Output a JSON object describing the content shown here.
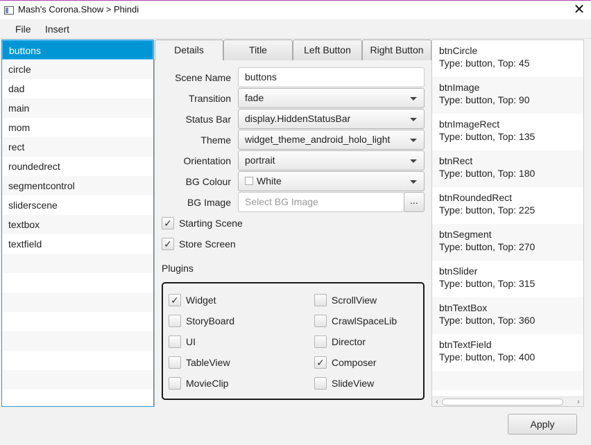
{
  "window": {
    "title": "Mash's Corona.Show > Phindi",
    "close_glyph": "✕"
  },
  "menu": {
    "file": "File",
    "insert": "Insert"
  },
  "scenes": [
    "buttons",
    "circle",
    "dad",
    "main",
    "mom",
    "rect",
    "roundedrect",
    "segmentcontrol",
    "sliderscene",
    "textbox",
    "textfield"
  ],
  "selected_scene": "buttons",
  "tabs": [
    "Details",
    "Title",
    "Left Button",
    "Right Button"
  ],
  "form": {
    "scene_name_label": "Scene Name",
    "scene_name_value": "buttons",
    "transition_label": "Transition",
    "transition_value": "fade",
    "status_bar_label": "Status Bar",
    "status_bar_value": "display.HiddenStatusBar",
    "theme_label": "Theme",
    "theme_value": "widget_theme_android_holo_light",
    "orientation_label": "Orientation",
    "orientation_value": "portrait",
    "bg_colour_label": "BG Colour",
    "bg_colour_value": "White",
    "bg_colour_swatch": "#ffffff",
    "bg_image_label": "BG Image",
    "bg_image_placeholder": "Select BG Image",
    "browse_label": "...",
    "starting_scene_label": "Starting Scene",
    "starting_scene_checked": true,
    "store_screen_label": "Store Screen",
    "store_screen_checked": true
  },
  "plugins": {
    "label": "Plugins",
    "left": [
      {
        "name": "Widget",
        "checked": true
      },
      {
        "name": "StoryBoard",
        "checked": false
      },
      {
        "name": "UI",
        "checked": false
      },
      {
        "name": "TableView",
        "checked": false
      },
      {
        "name": "MovieClip",
        "checked": false
      }
    ],
    "right": [
      {
        "name": "ScrollView",
        "checked": false
      },
      {
        "name": "CrawlSpaceLib",
        "checked": false
      },
      {
        "name": "Director",
        "checked": false
      },
      {
        "name": "Composer",
        "checked": true
      },
      {
        "name": "SlideView",
        "checked": false
      }
    ]
  },
  "objects": [
    {
      "name": "btnCircle",
      "info": "Type: button, Top: 45"
    },
    {
      "name": "btnImage",
      "info": "Type: button, Top: 90"
    },
    {
      "name": "btnImageRect",
      "info": "Type: button, Top: 135"
    },
    {
      "name": "btnRect",
      "info": "Type: button, Top: 180"
    },
    {
      "name": "btnRoundedRect",
      "info": "Type: button, Top: 225"
    },
    {
      "name": "btnSegment",
      "info": "Type: button, Top: 270"
    },
    {
      "name": "btnSlider",
      "info": "Type: button, Top: 315"
    },
    {
      "name": "btnTextBox",
      "info": "Type: button, Top: 360"
    },
    {
      "name": "btnTextField",
      "info": "Type: button, Top: 400"
    }
  ],
  "apply_label": "Apply",
  "colors": {
    "selection": "#0096d6",
    "list_border": "#2a9bd6",
    "plugins_border": "#1a1a1a"
  }
}
